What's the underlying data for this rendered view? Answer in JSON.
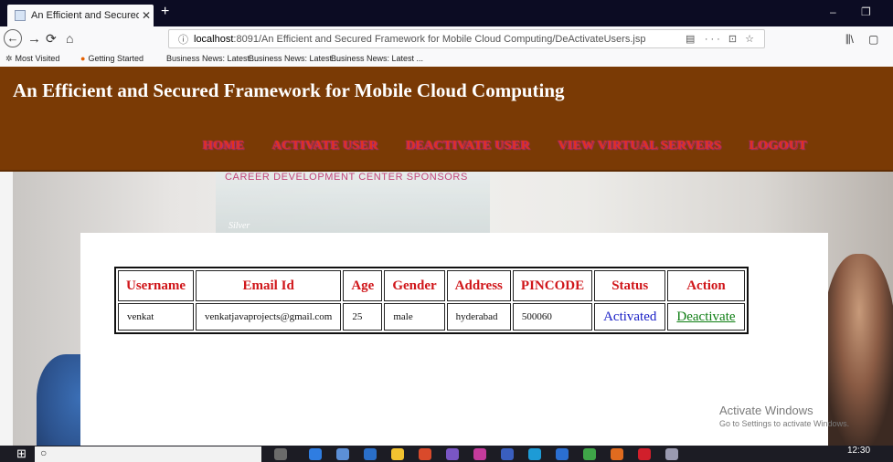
{
  "browser": {
    "tab_title": "An Efficient and Secured Frame",
    "tab_close": "✕",
    "new_tab": "+",
    "url_host": "localhost",
    "url_path": ":8091/An Efficient and Secured Framework for Mobile Cloud Computing/DeActivateUsers.jsp",
    "url_actions": "··· ⊡ ☆",
    "reader_icon": "▤",
    "library_icon": "⫼\\",
    "sidebar_icon": "▢",
    "window_min": "–",
    "window_restore": "❐"
  },
  "bookmarks": [
    {
      "label": "Most Visited",
      "icon": "gear-icon"
    },
    {
      "label": "Getting Started",
      "icon": "firefox-icon"
    },
    {
      "label": "Business News: Latest ..."
    },
    {
      "label": "Business News: Latest ..."
    },
    {
      "label": "Business News: Latest ..."
    }
  ],
  "site": {
    "title": "An Efficient and Secured Framework for Mobile Cloud Computing",
    "menu": [
      "HOME",
      "ACTIVATE USER",
      "DEACTIVATE USER",
      "VIEW VIRTUAL SERVERS",
      "LOGOUT"
    ]
  },
  "hero": {
    "sponsors_text": "CAREER DEVELOPMENT CENTER SPONSORS",
    "silver_text": "Silver"
  },
  "users_table": {
    "headers": [
      "Username",
      "Email Id",
      "Age",
      "Gender",
      "Address",
      "PINCODE",
      "Status",
      "Action"
    ],
    "rows": [
      {
        "username": "venkat",
        "email": "venkatjavaprojects@gmail.com",
        "age": "25",
        "gender": "male",
        "address": "hyderabad",
        "pincode": "500060",
        "status": "Activated",
        "action": "Deactivate"
      }
    ]
  },
  "watermark": {
    "title": "Activate Windows",
    "subtitle": "Go to Settings to activate Windows."
  },
  "taskbar": {
    "start_icon": "⊞",
    "search_icon": "○",
    "clock": "12:30"
  }
}
